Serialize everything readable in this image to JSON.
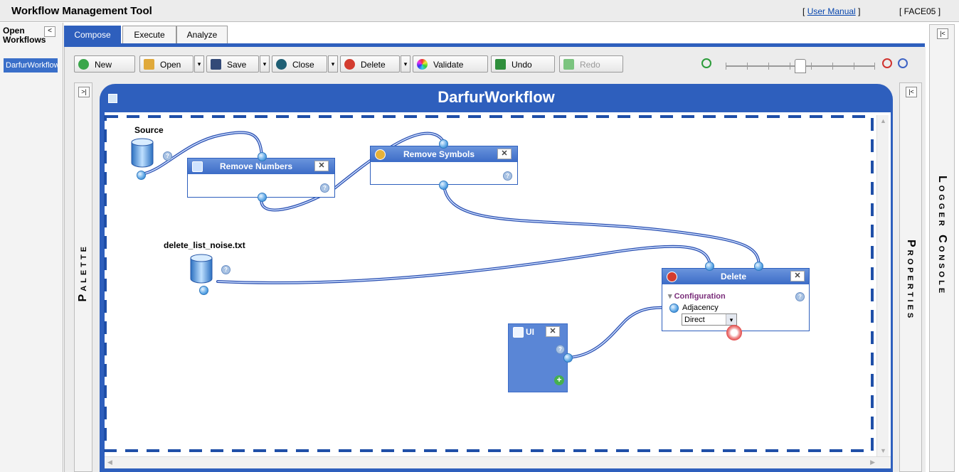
{
  "app": {
    "title": "Workflow Management Tool",
    "manual_link": "User Manual",
    "manual_bracket_open": "[",
    "manual_bracket_close": "]",
    "user": "[ FACE05 ]"
  },
  "left_panel": {
    "title_line1": "Open",
    "title_line2": "Workflows",
    "collapse": "<",
    "items": [
      "DarfurWorkflow"
    ]
  },
  "tabs": [
    {
      "label": "Compose",
      "active": true
    },
    {
      "label": "Execute"
    },
    {
      "label": "Analyze"
    }
  ],
  "toolbar": {
    "new": "New",
    "open": "Open",
    "save": "Save",
    "close": "Close",
    "delete": "Delete",
    "validate": "Validate",
    "undo": "Undo",
    "redo": "Redo",
    "dropdown": "▾"
  },
  "palette": {
    "label": "Palette",
    "expand": ">|"
  },
  "properties": {
    "label": "Properties",
    "collapse": "|<"
  },
  "logger": {
    "label": "Logger Console",
    "collapse": "|<"
  },
  "canvas": {
    "title": "DarfurWorkflow",
    "nodes": {
      "source": {
        "label": "Source"
      },
      "remove_numbers": {
        "title": "Remove Numbers"
      },
      "remove_symbols": {
        "title": "Remove Symbols"
      },
      "delete_list": {
        "label": "delete_list_noise.txt"
      },
      "delete": {
        "title": "Delete",
        "config": "Configuration",
        "param": "Adjacency",
        "param_value": "Direct"
      },
      "ui": {
        "title": "UI"
      }
    },
    "close_symbol": "✕",
    "help_symbol": "?"
  },
  "colors": {
    "accent": "#2e5fbd",
    "link": "#0645ad",
    "wire": "#3a62c4"
  }
}
